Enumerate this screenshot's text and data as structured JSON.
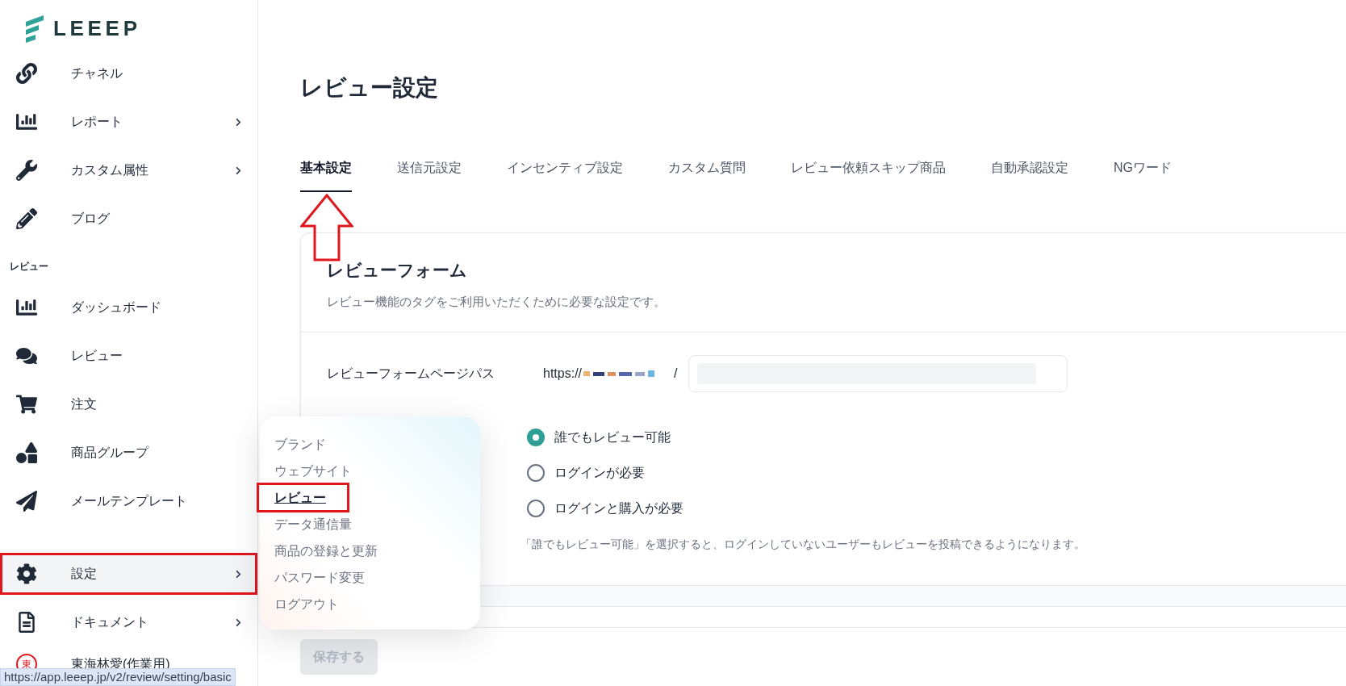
{
  "logo": {
    "text": "LEEEP"
  },
  "sidebar": {
    "items": [
      {
        "kind": "link",
        "label": "チャネル",
        "has_submenu": false,
        "selected": false
      },
      {
        "kind": "chart",
        "label": "レポート",
        "has_submenu": true,
        "selected": false
      },
      {
        "kind": "wrench",
        "label": "カスタム属性",
        "has_submenu": true,
        "selected": false
      },
      {
        "kind": "pencil",
        "label": "ブログ",
        "has_submenu": false,
        "selected": false
      },
      {
        "kind": "section",
        "label": "レビュー"
      },
      {
        "kind": "chart",
        "label": "ダッシュボード",
        "has_submenu": false,
        "selected": false
      },
      {
        "kind": "comments",
        "label": "レビュー",
        "has_submenu": false,
        "selected": false
      },
      {
        "kind": "cart",
        "label": "注文",
        "has_submenu": false,
        "selected": false
      },
      {
        "kind": "shapes",
        "label": "商品グループ",
        "has_submenu": false,
        "selected": false
      },
      {
        "kind": "plane",
        "label": "メールテンプレート",
        "has_submenu": false,
        "selected": false
      },
      {
        "kind": "gap"
      },
      {
        "kind": "gear",
        "label": "設定",
        "has_submenu": true,
        "selected": true
      },
      {
        "kind": "document",
        "label": "ドキュメント",
        "has_submenu": true,
        "selected": false
      }
    ],
    "user": {
      "avatar": "東",
      "name": "東海林愛(作業用)"
    }
  },
  "page": {
    "title": "レビュー設定"
  },
  "tabs": [
    {
      "label": "基本設定",
      "selected": true
    },
    {
      "label": "送信元設定",
      "selected": false
    },
    {
      "label": "インセンティブ設定",
      "selected": false
    },
    {
      "label": "カスタム質問",
      "selected": false
    },
    {
      "label": "レビュー依頼スキップ商品",
      "selected": false
    },
    {
      "label": "自動承認設定",
      "selected": false
    },
    {
      "label": "NGワード",
      "selected": false
    }
  ],
  "card": {
    "title": "レビューフォーム",
    "description": "レビュー機能のタグをご利用いただくために必要な設定です。",
    "path_row": {
      "label": "レビューフォームページパス",
      "prefix": "https://",
      "separator": "/"
    },
    "options": [
      {
        "label": "誰でもレビュー可能",
        "selected": true
      },
      {
        "label": "ログインが必要",
        "selected": false
      },
      {
        "label": "ログインと購入が必要",
        "selected": false
      }
    ],
    "help": "「誰でもレビュー可能」を選択すると、ログインしていないユーザーもレビューを投稿できるようになります。"
  },
  "save_button": {
    "label": "保存する",
    "disabled": true
  },
  "settings_menu": {
    "items": [
      {
        "label": "ブランド",
        "selected": false
      },
      {
        "label": "ウェブサイト",
        "selected": false
      },
      {
        "label": "レビュー",
        "selected": true
      },
      {
        "label": "データ通信量",
        "selected": false
      },
      {
        "label": "商品の登録と更新",
        "selected": false
      },
      {
        "label": "パスワード変更",
        "selected": false
      },
      {
        "label": "ログアウト",
        "selected": false
      }
    ]
  },
  "status_bar": {
    "url": "https://app.leeep.jp/v2/review/setting/basic"
  }
}
